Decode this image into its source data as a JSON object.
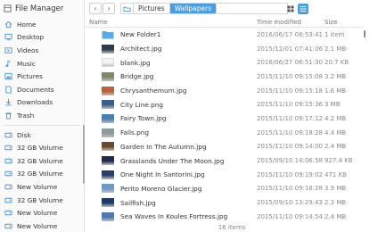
{
  "window": {
    "title": "File Manager"
  },
  "sidebar": {
    "places": [
      {
        "label": "Home",
        "icon": "home-icon"
      },
      {
        "label": "Desktop",
        "icon": "desktop-icon"
      },
      {
        "label": "Videos",
        "icon": "videos-icon"
      },
      {
        "label": "Music",
        "icon": "music-icon"
      },
      {
        "label": "Pictures",
        "icon": "pictures-icon"
      },
      {
        "label": "Documents",
        "icon": "documents-icon"
      },
      {
        "label": "Downloads",
        "icon": "downloads-icon"
      },
      {
        "label": "Trash",
        "icon": "trash-icon"
      }
    ],
    "devices": [
      {
        "label": "Disk"
      },
      {
        "label": "32 GB Volume"
      },
      {
        "label": "32 GB Volume"
      },
      {
        "label": "32 GB Volume"
      },
      {
        "label": "New Volume"
      },
      {
        "label": "32 GB Volume"
      },
      {
        "label": "New Volume"
      },
      {
        "label": "New Volume"
      }
    ]
  },
  "topbar": {
    "back": "‹",
    "forward": "›",
    "breadcrumbs": [
      "Pictures",
      "Wallpapers"
    ]
  },
  "table": {
    "headers": {
      "name": "Name",
      "time": "Time modified",
      "size": "Size"
    },
    "rows": [
      {
        "name": "New Folder1",
        "time": "2016/06/17 08:53:41",
        "size": "1 item",
        "thumb": "folder",
        "color": "#5aa8e8"
      },
      {
        "name": "Architect.jpg",
        "time": "2015/12/01 07:41:06",
        "size": "2.1 MB",
        "thumb": "img",
        "color": "#2c3a4a"
      },
      {
        "name": "blank.jpg",
        "time": "2016/06/27 06:51:30",
        "size": "20.7 KB",
        "thumb": "img",
        "color": "#f4f4f4"
      },
      {
        "name": "Bridge.jpg",
        "time": "2015/11/10 09:15:08",
        "size": "3.2 MB",
        "thumb": "img",
        "color": "#7d8a6a"
      },
      {
        "name": "Chrysanthemum.jpg",
        "time": "2015/11/10 09:15:18",
        "size": "1.6 MB",
        "thumb": "img",
        "color": "#b8623a"
      },
      {
        "name": "City Line.png",
        "time": "2015/11/10 09:15:36",
        "size": "3 MB",
        "thumb": "img",
        "color": "#3a5d8c"
      },
      {
        "name": "Fairy Town.jpg",
        "time": "2015/11/10 09:17:12",
        "size": "4.2 MB",
        "thumb": "img",
        "color": "#4a7fb0"
      },
      {
        "name": "Falls.png",
        "time": "2015/11/10 09:18:28",
        "size": "4.4 MB",
        "thumb": "img",
        "color": "#8a9a9a"
      },
      {
        "name": "Garden In The Autumn.jpg",
        "time": "2015/11/10 09:14:00",
        "size": "2.4 MB",
        "thumb": "img",
        "color": "#6b4a2a"
      },
      {
        "name": "Grasslands Under The Moon.jpg",
        "time": "2015/09/10 14:06:58",
        "size": "927.4 KB",
        "thumb": "img",
        "color": "#1d2a4a"
      },
      {
        "name": "One Night In Santorini.jpg",
        "time": "2015/11/10 09:19:02",
        "size": "471 KB",
        "thumb": "img",
        "color": "#2a3f6a"
      },
      {
        "name": "Perito Moreno Glacier.jpg",
        "time": "2015/11/10 09:18:28",
        "size": "3.9 MB",
        "thumb": "img",
        "color": "#6a9ac8"
      },
      {
        "name": "Sailfish.jpg",
        "time": "2015/09/10 13:29:43",
        "size": "2.3 MB",
        "thumb": "img",
        "color": "#1a3a6a"
      },
      {
        "name": "Sea Waves In Koules Fortress.jpg",
        "time": "2015/11/10 09:14:54",
        "size": "2.4 MB",
        "thumb": "img",
        "color": "#4a7ab0"
      }
    ]
  },
  "footer": {
    "count": "16 items"
  },
  "colors": {
    "accent": "#4a9ee6",
    "sidebar_bg": "#fafafa"
  }
}
